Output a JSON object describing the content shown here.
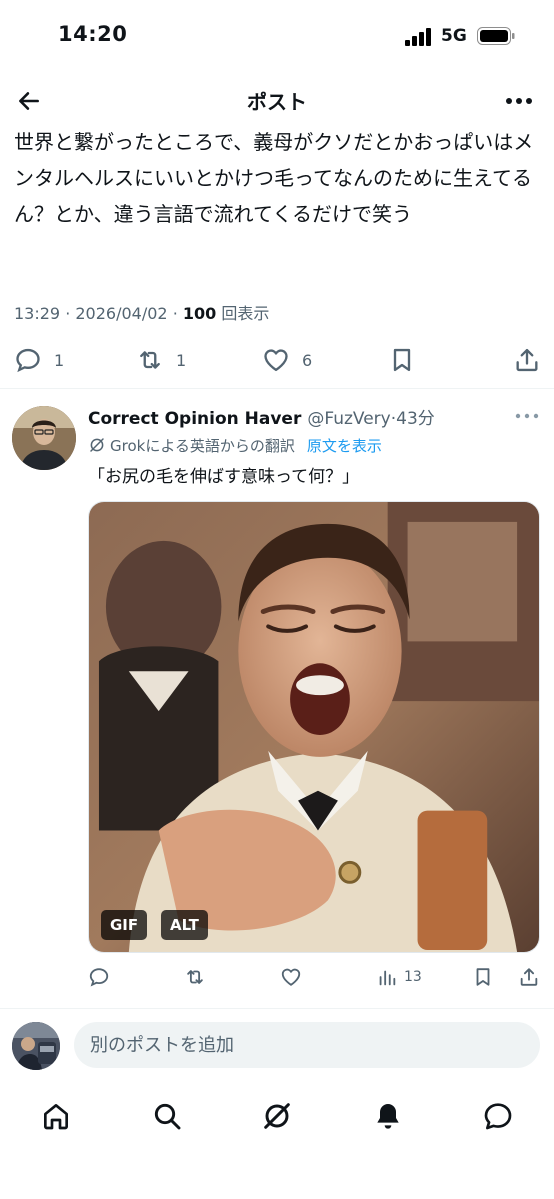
{
  "status_bar": {
    "time": "14:20",
    "network": "5G"
  },
  "nav": {
    "title": "ポスト"
  },
  "post": {
    "text": "世界と繋がったところで、義母がクソだとかおっぱいはメンタルヘルスにいいとかけつ毛ってなんのために生えてるん？とか、違う言語で流れてくるだけで笑う",
    "time": "13:29",
    "date": "2026/04/02",
    "views_count": "100",
    "views_label": "回表示",
    "reply_count": "1",
    "repost_count": "1",
    "like_count": "6"
  },
  "reply": {
    "name": "Correct Opinion Haver",
    "handle": "@FuzVery",
    "age": "43分",
    "translate_label": "Grokによる英語からの翻訳",
    "show_original": "原文を表示",
    "text": "「お尻の毛を伸ばす意味って何？」",
    "media_badge_gif": "GIF",
    "media_badge_alt": "ALT",
    "view_count": "13"
  },
  "compose": {
    "placeholder": "別のポストを追加"
  },
  "icons": {
    "back": "arrow-left-icon",
    "more": "more-horizontal-icon",
    "reply": "speech-bubble-icon",
    "repost": "repost-icon",
    "like": "heart-icon",
    "bookmark": "bookmark-icon",
    "share": "share-icon",
    "views": "bar-chart-icon",
    "grok": "grok-slash-icon",
    "home": "home-icon",
    "search": "search-icon",
    "notifications": "bell-icon",
    "messages": "message-icon"
  },
  "colors": {
    "accent": "#1d9bf0",
    "text": "#0f1419",
    "muted": "#536471"
  }
}
